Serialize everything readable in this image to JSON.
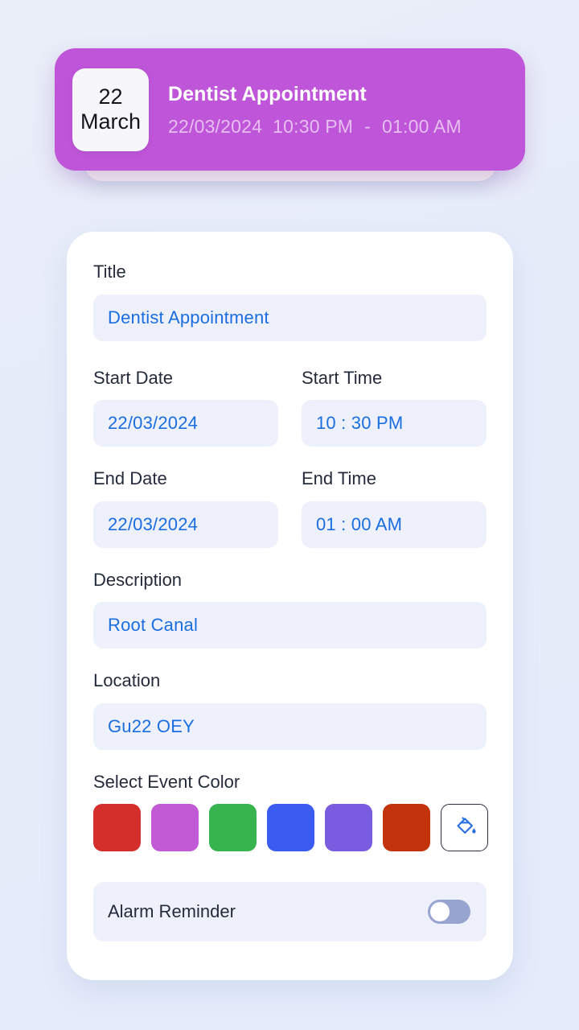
{
  "banner": {
    "day": "22",
    "month": "March",
    "title": "Dentist Appointment",
    "date": "22/03/2024",
    "start_time": "10:30 PM",
    "separator": "-",
    "end_time": "01:00 AM",
    "background_color": "#bf55d8"
  },
  "form": {
    "title_label": "Title",
    "title_value": "Dentist Appointment",
    "start_date_label": "Start Date",
    "start_date_value": "22/03/2024",
    "start_time_label": "Start Time",
    "start_time_value": "10 : 30 PM",
    "end_date_label": "End Date",
    "end_date_value": "22/03/2024",
    "end_time_label": "End Time",
    "end_time_value": "01 : 00 AM",
    "description_label": "Description",
    "description_value": "Root Canal",
    "location_label": "Location",
    "location_value": "Gu22 OEY",
    "color_label": "Select Event Color",
    "colors": [
      {
        "name": "red",
        "hex": "#d42f2a"
      },
      {
        "name": "orchid",
        "hex": "#c25ad5"
      },
      {
        "name": "green",
        "hex": "#37b44e"
      },
      {
        "name": "blue",
        "hex": "#3a5cf0"
      },
      {
        "name": "violet",
        "hex": "#7a5ce0"
      },
      {
        "name": "dark-orange",
        "hex": "#c2330b"
      }
    ],
    "custom_color_icon": "paint-bucket-icon",
    "custom_color_icon_hex": "#2a6fe0",
    "alarm_label": "Alarm Reminder",
    "alarm_enabled": false,
    "input_text_color": "#1a6ee0",
    "input_background": "#eef1fb"
  }
}
